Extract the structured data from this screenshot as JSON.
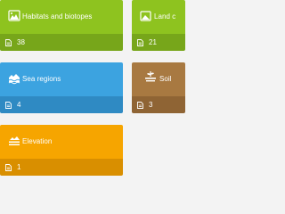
{
  "colors": {
    "habitats_top": "#8ec31f",
    "habitats_bottom": "#77a61a",
    "land_top": "#8ec31f",
    "land_bottom": "#77a61a",
    "sea_top": "#3ca3e0",
    "sea_bottom": "#2f8ac3",
    "soil_top": "#a87941",
    "soil_bottom": "#8f6434",
    "elevation_top": "#f6a500",
    "elevation_bottom": "#d98f00"
  },
  "tiles": [
    {
      "title": "Habitats and biotopes",
      "count": "38",
      "icon": "habitat-icon"
    },
    {
      "title": "Land c",
      "count": "21",
      "icon": "land-cover-icon"
    },
    {
      "title": "Sea regions",
      "count": "4",
      "icon": "sea-icon"
    },
    {
      "title": "Soil",
      "count": "3",
      "icon": "soil-icon"
    },
    {
      "title": "Elevation",
      "count": "1",
      "icon": "elevation-icon"
    }
  ],
  "document_icon": "document-icon"
}
